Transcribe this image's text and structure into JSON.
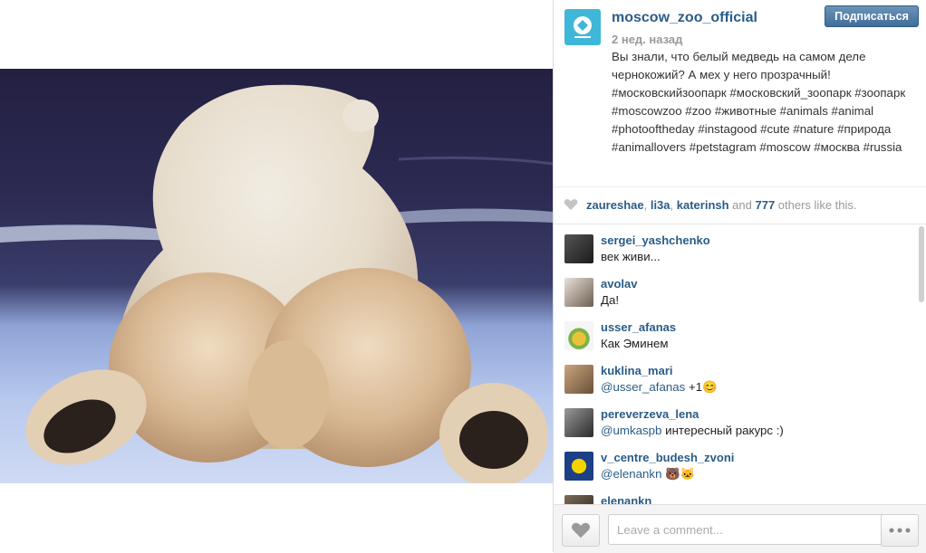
{
  "post": {
    "username": "moscow_zoo_official",
    "time_ago": "2 нед. назад",
    "follow_label": "Подписаться",
    "caption": "Вы знали, что белый медведь на самом деле чернокожий? А мех у него прозрачный! #московскийзоопарк #московский_зоопарк #зоопарк #moscowzoo #zoo #животные #animals #animal #photooftheday #instagood #cute #nature #природа #animallovers #petstagram #moscow #москва #russia",
    "avatar_icon": "zoo-logo-icon",
    "accent_color": "#2a5c88",
    "photo_subject": "polar-bear-photo"
  },
  "likes": {
    "users": [
      "zaureshae",
      "li3a",
      "katerinsh"
    ],
    "sep1": ", ",
    "sep2": ", ",
    "middle": " and ",
    "count": "777",
    "suffix": " others like this.",
    "icon": "heart-icon"
  },
  "comments": [
    {
      "user": "sergei_yashchenko",
      "text": "век живи..."
    },
    {
      "user": "avolav",
      "text": "Да!"
    },
    {
      "user": "usser_afanas",
      "text": "Как Эминем"
    },
    {
      "user": "kuklina_mari",
      "mention": "@usser_afanas",
      "text": " +1",
      "emoji": "😊"
    },
    {
      "user": "pereverzeva_lena",
      "mention": "@umkaspb",
      "text": " интересный ракурс :)"
    },
    {
      "user": "v_centre_budesh_zvoni",
      "mention": "@elenankn",
      "text": " ",
      "emoji": "🐻🐱"
    },
    {
      "user": "elenankn",
      "text": ""
    }
  ],
  "footer": {
    "comment_placeholder": "Leave a comment...",
    "like_icon": "heart-icon",
    "more_icon": "more-options-icon"
  }
}
